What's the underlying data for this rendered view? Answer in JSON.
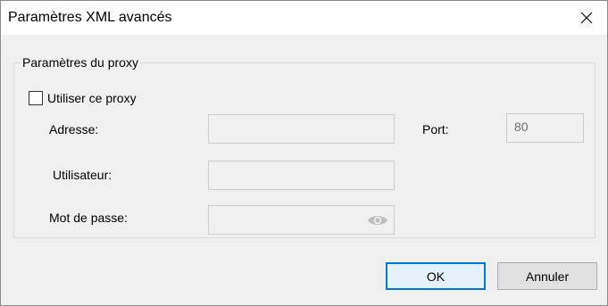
{
  "dialog": {
    "title": "Paramètres XML avancés",
    "close_icon": "close-icon"
  },
  "proxy_group": {
    "legend": "Paramètres du proxy",
    "use_proxy": {
      "label": "Utiliser ce proxy",
      "checked": false
    },
    "address": {
      "label": "Adresse:",
      "value": ""
    },
    "port": {
      "label": "Port:",
      "value": "80"
    },
    "user": {
      "label": "Utilisateur:",
      "value": ""
    },
    "password": {
      "label": "Mot de passe:",
      "value": "",
      "toggle_icon": "eye-icon"
    }
  },
  "buttons": {
    "ok_label": "OK",
    "cancel_label": "Annuler"
  },
  "colors": {
    "accent": "#0078d7",
    "dialog_bg": "#f0f0f0",
    "titlebar_bg": "#ffffff"
  }
}
